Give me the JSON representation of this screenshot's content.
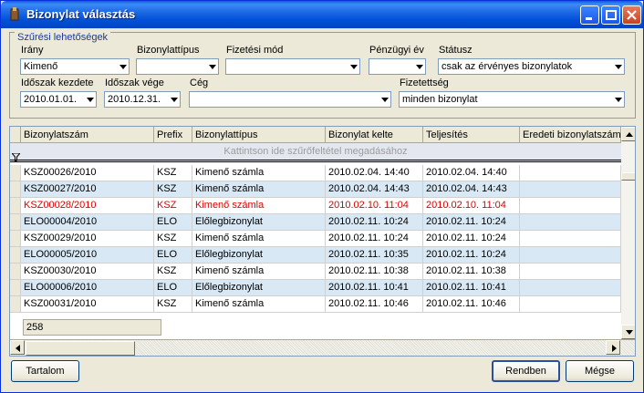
{
  "window": {
    "title": "Bizonylat választás"
  },
  "filters": {
    "legend": "Szűrési lehetőségek",
    "irany": {
      "label": "Irány",
      "value": "Kimenő"
    },
    "bizonylattipus": {
      "label": "Bizonylattípus",
      "value": ""
    },
    "fizetesi_mod": {
      "label": "Fizetési mód",
      "value": ""
    },
    "penzugyi_ev": {
      "label": "Pénzügyi év",
      "value": ""
    },
    "statusz": {
      "label": "Státusz",
      "value": "csak az érvényes bizonylatok"
    },
    "idoszak_kezdete": {
      "label": "Időszak kezdete",
      "value": "2010.01.01."
    },
    "idoszak_vege": {
      "label": "Időszak vége",
      "value": "2010.12.31."
    },
    "ceg": {
      "label": "Cég",
      "value": ""
    },
    "fizetettseg": {
      "label": "Fizetettség",
      "value": "minden bizonylat"
    }
  },
  "grid": {
    "columns": [
      "Bizonylatszám",
      "Prefix",
      "Bizonylattípus",
      "Bizonylat kelte",
      "Teljesítés",
      "Eredeti bizonylatszám"
    ],
    "filter_hint": "Kattintson ide szűrőfeltétel megadásához",
    "rows": [
      {
        "c": [
          "KSZ00026/2010",
          "KSZ",
          "Kimenő számla",
          "2010.02.04. 14:40",
          "2010.02.04. 14:40",
          ""
        ],
        "red": false
      },
      {
        "c": [
          "KSZ00027/2010",
          "KSZ",
          "Kimenő számla",
          "2010.02.04. 14:43",
          "2010.02.04. 14:43",
          ""
        ],
        "red": false
      },
      {
        "c": [
          "KSZ00028/2010",
          "KSZ",
          "Kimenő számla",
          "2010.02.10. 11:04",
          "2010.02.10. 11:04",
          ""
        ],
        "red": true
      },
      {
        "c": [
          "ELO00004/2010",
          "ELO",
          "Előlegbizonylat",
          "2010.02.11. 10:24",
          "2010.02.11. 10:24",
          ""
        ],
        "red": false
      },
      {
        "c": [
          "KSZ00029/2010",
          "KSZ",
          "Kimenő számla",
          "2010.02.11. 10:24",
          "2010.02.11. 10:24",
          ""
        ],
        "red": false
      },
      {
        "c": [
          "ELO00005/2010",
          "ELO",
          "Előlegbizonylat",
          "2010.02.11. 10:35",
          "2010.02.11. 10:24",
          ""
        ],
        "red": false
      },
      {
        "c": [
          "KSZ00030/2010",
          "KSZ",
          "Kimenő számla",
          "2010.02.11. 10:38",
          "2010.02.11. 10:38",
          ""
        ],
        "red": false
      },
      {
        "c": [
          "ELO00006/2010",
          "ELO",
          "Előlegbizonylat",
          "2010.02.11. 10:41",
          "2010.02.11. 10:41",
          ""
        ],
        "red": false
      },
      {
        "c": [
          "KSZ00031/2010",
          "KSZ",
          "Kimenő számla",
          "2010.02.11. 10:46",
          "2010.02.11. 10:46",
          ""
        ],
        "red": false
      }
    ],
    "count": "258"
  },
  "buttons": {
    "tartalom": "Tartalom",
    "rendben": "Rendben",
    "megse": "Mégse"
  },
  "colors": {
    "title_bar": "#0050d8",
    "alt_row": "#d8e8f5",
    "highlight_text": "#e00000"
  }
}
